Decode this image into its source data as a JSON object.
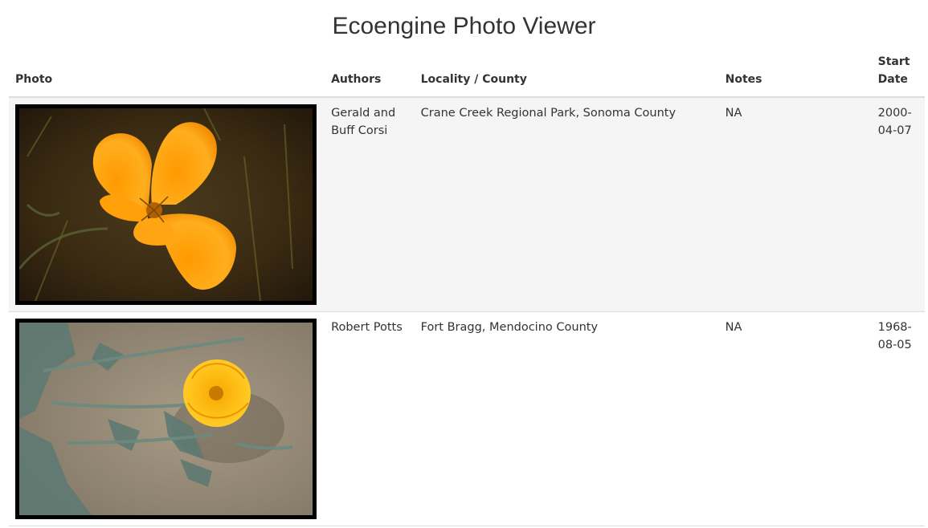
{
  "page": {
    "title": "Ecoengine Photo Viewer"
  },
  "table": {
    "headers": {
      "photo": "Photo",
      "authors": "Authors",
      "locality": "Locality / County",
      "notes": "Notes",
      "start_date": "Start Date"
    },
    "rows": [
      {
        "photo_icon": "orange-poppy-flower-photo",
        "authors": "Gerald and Buff Corsi",
        "locality": "Crane Creek Regional Park, Sonoma County",
        "notes": "NA",
        "start_date": "2000-04-07"
      },
      {
        "photo_icon": "yellow-poppy-on-sand-photo",
        "authors": "Robert Potts",
        "locality": "Fort Bragg, Mendocino County",
        "notes": "NA",
        "start_date": "1968-08-05"
      }
    ]
  },
  "colors": {
    "stripe": "#f5f5f5",
    "border": "#dddddd",
    "text": "#333333"
  }
}
